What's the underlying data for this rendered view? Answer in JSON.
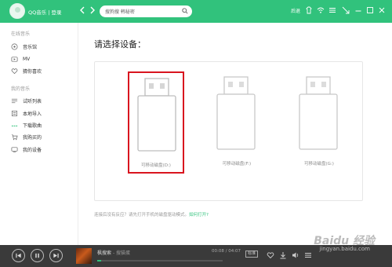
{
  "app": {
    "title": "QQ音乐 | 登录",
    "brand_color": "#31c27c"
  },
  "header": {
    "back_icon": "chevron-left-icon",
    "forward_icon": "chevron-right-icon",
    "search": {
      "placeholder": "",
      "value": "搜狗搜 韩秘密",
      "icon": "search-icon"
    },
    "right": {
      "label": "后退",
      "icons": [
        "skin-icon",
        "wifi-icon",
        "menu-icon",
        "mini-mode-icon",
        "minimize-icon",
        "maximize-icon",
        "close-icon"
      ]
    }
  },
  "sidebar": {
    "section1": "在线音乐",
    "online": [
      {
        "label": "音乐馆",
        "icon": "music-hall-icon"
      },
      {
        "label": "MV",
        "icon": "mv-icon"
      },
      {
        "label": "猜你喜欢",
        "icon": "heart-icon"
      }
    ],
    "section2": "我的音乐",
    "mine": [
      {
        "label": "试听列表",
        "icon": "list-icon"
      },
      {
        "label": "本地导入",
        "icon": "local-import-icon"
      },
      {
        "label": "下载歌曲",
        "icon": "download-icon"
      },
      {
        "label": "我购买的",
        "icon": "cart-icon"
      },
      {
        "label": "我的设备",
        "icon": "device-icon"
      }
    ]
  },
  "main": {
    "title": "请选择设备：",
    "devices": [
      {
        "label": "可移动磁盘(D:)",
        "selected": true,
        "icon": "usb-drive-icon"
      },
      {
        "label": "可移动磁盘(F:)",
        "selected": false,
        "icon": "usb-drive-icon"
      },
      {
        "label": "可移动磁盘(G:)",
        "selected": false,
        "icon": "usb-drive-icon"
      }
    ],
    "hint": "连接后没有反应？请先打开手机的磁盘驱动模式。",
    "hint_link": "如何打开?"
  },
  "player": {
    "song_title": "枫搜索",
    "artist": "搜猫蛋",
    "time": "00:08 / 04:07",
    "progress": 0.03,
    "quality": "标准",
    "icons": [
      "heart-icon",
      "download-icon",
      "volume-icon",
      "playlist-icon"
    ]
  },
  "watermark": {
    "text": "Baidu 经验",
    "url": "jingyan.baidu.com"
  }
}
